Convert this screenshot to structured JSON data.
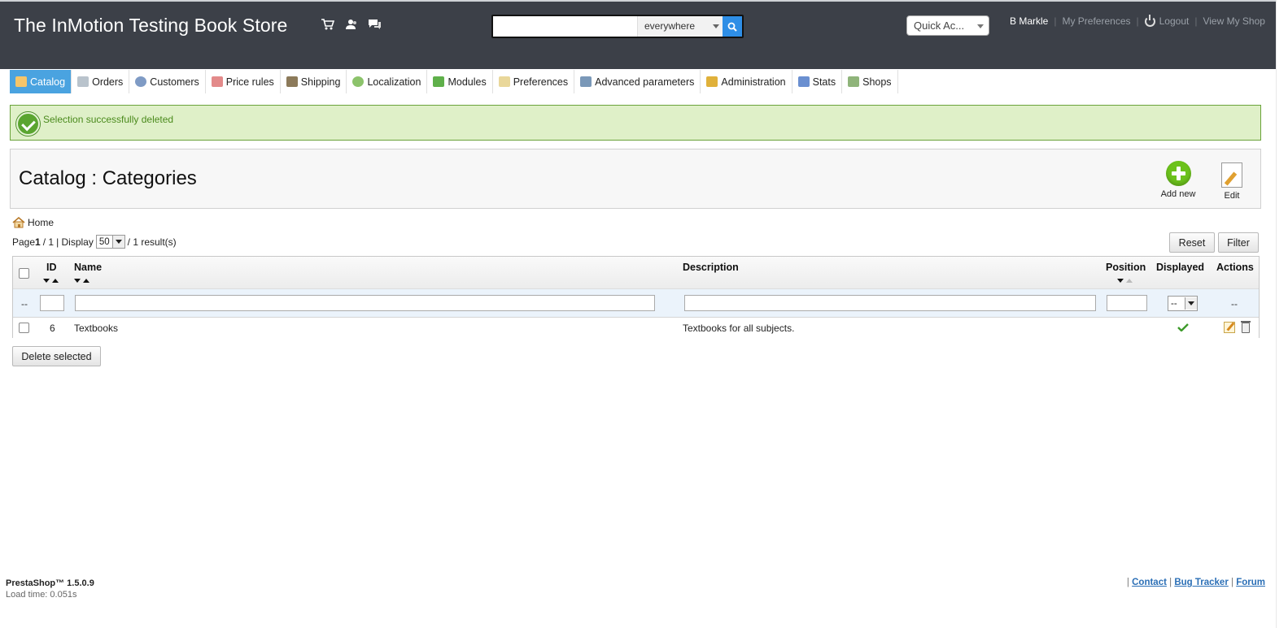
{
  "header": {
    "shop_name": "The InMotion Testing Book Store",
    "icons": [
      "cart-icon",
      "customers-icon",
      "messages-icon"
    ],
    "search": {
      "value": "",
      "scope": "everywhere"
    },
    "quick_access": "Quick Ac...",
    "user": "B Markle",
    "links": {
      "preferences": "My Preferences",
      "logout": "Logout",
      "view_shop": "View My Shop"
    }
  },
  "nav": [
    {
      "label": "Catalog",
      "active": true
    },
    {
      "label": "Orders"
    },
    {
      "label": "Customers"
    },
    {
      "label": "Price rules"
    },
    {
      "label": "Shipping"
    },
    {
      "label": "Localization"
    },
    {
      "label": "Modules"
    },
    {
      "label": "Preferences"
    },
    {
      "label": "Advanced parameters"
    },
    {
      "label": "Administration"
    },
    {
      "label": "Stats"
    },
    {
      "label": "Shops"
    }
  ],
  "alert": {
    "message": "Selection successfully deleted"
  },
  "toolbar": {
    "title": "Catalog : Categories",
    "add_label": "Add new",
    "edit_label": "Edit"
  },
  "breadcrumb": {
    "home": "Home"
  },
  "pager": {
    "page_label": "Page",
    "page_current": "1",
    "page_total": "/ 1",
    "display_label": "| Display",
    "per_page": "50",
    "results": "/ 1 result(s)"
  },
  "buttons": {
    "reset": "Reset",
    "filter": "Filter",
    "delete_selected": "Delete selected"
  },
  "table": {
    "columns": {
      "id": "ID",
      "name": "Name",
      "description": "Description",
      "position": "Position",
      "displayed": "Displayed",
      "actions": "Actions"
    },
    "filter": {
      "dash_left": "--",
      "displayed_value": "--",
      "dash_right": "--"
    },
    "rows": [
      {
        "id": "6",
        "name": "Textbooks",
        "description": "Textbooks for all subjects.",
        "displayed": true
      }
    ]
  },
  "footer": {
    "version": "PrestaShop™ 1.5.0.9",
    "load_time": "Load time: 0.051s",
    "sep": "|",
    "links": {
      "contact": "Contact",
      "bug_tracker": "Bug Tracker",
      "forum": "Forum"
    }
  },
  "colors": {
    "header_bg": "#3c4048",
    "active_tab": "#4aa3e0",
    "success_bg": "#dff0c8",
    "success_text": "#4a8a1c",
    "link": "#2b6fb6"
  }
}
